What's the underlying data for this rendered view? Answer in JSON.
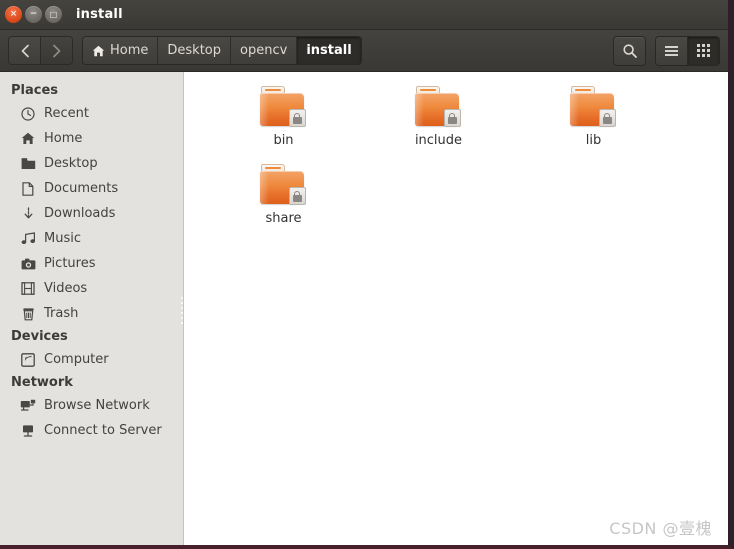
{
  "window": {
    "title": "install",
    "controls": [
      {
        "name": "close",
        "glyph": "×"
      },
      {
        "name": "minimize",
        "glyph": "−"
      },
      {
        "name": "maximize",
        "glyph": "□"
      }
    ]
  },
  "toolbar": {
    "back_label": "‹",
    "forward_label": "›",
    "breadcrumbs": [
      {
        "label": "Home",
        "icon": "home-icon",
        "active": false
      },
      {
        "label": "Desktop",
        "icon": "",
        "active": false
      },
      {
        "label": "opencv",
        "icon": "",
        "active": false
      },
      {
        "label": "install",
        "icon": "",
        "active": true
      }
    ],
    "search_icon": "search-icon",
    "view_list_icon": "list-view-icon",
    "view_grid_icon": "grid-view-icon",
    "active_view": "grid"
  },
  "sidebar": {
    "sections": [
      {
        "heading": "Places",
        "items": [
          {
            "label": "Recent",
            "icon": "clock-icon"
          },
          {
            "label": "Home",
            "icon": "home-icon"
          },
          {
            "label": "Desktop",
            "icon": "folder-icon"
          },
          {
            "label": "Documents",
            "icon": "document-icon"
          },
          {
            "label": "Downloads",
            "icon": "download-icon"
          },
          {
            "label": "Music",
            "icon": "music-note-icon"
          },
          {
            "label": "Pictures",
            "icon": "camera-icon"
          },
          {
            "label": "Videos",
            "icon": "film-icon"
          },
          {
            "label": "Trash",
            "icon": "trash-icon"
          }
        ]
      },
      {
        "heading": "Devices",
        "items": [
          {
            "label": "Computer",
            "icon": "computer-icon"
          }
        ]
      },
      {
        "heading": "Network",
        "items": [
          {
            "label": "Browse Network",
            "icon": "network-icon"
          },
          {
            "label": "Connect to Server",
            "icon": "server-icon"
          }
        ]
      }
    ]
  },
  "files": [
    {
      "label": "bin",
      "type": "folder",
      "emblem": "lock-icon"
    },
    {
      "label": "include",
      "type": "folder",
      "emblem": "lock-icon"
    },
    {
      "label": "lib",
      "type": "folder",
      "emblem": "lock-icon"
    },
    {
      "label": "share",
      "type": "folder",
      "emblem": "lock-icon"
    }
  ],
  "watermark": {
    "text": "CSDN @壹槐"
  },
  "colors": {
    "titlebar": "#3f3d39",
    "sidebar_bg": "#e4e2df",
    "folder_orange": "#ea7a2e",
    "accent_close": "#df4c1c",
    "content_bg": "#ffffff"
  }
}
